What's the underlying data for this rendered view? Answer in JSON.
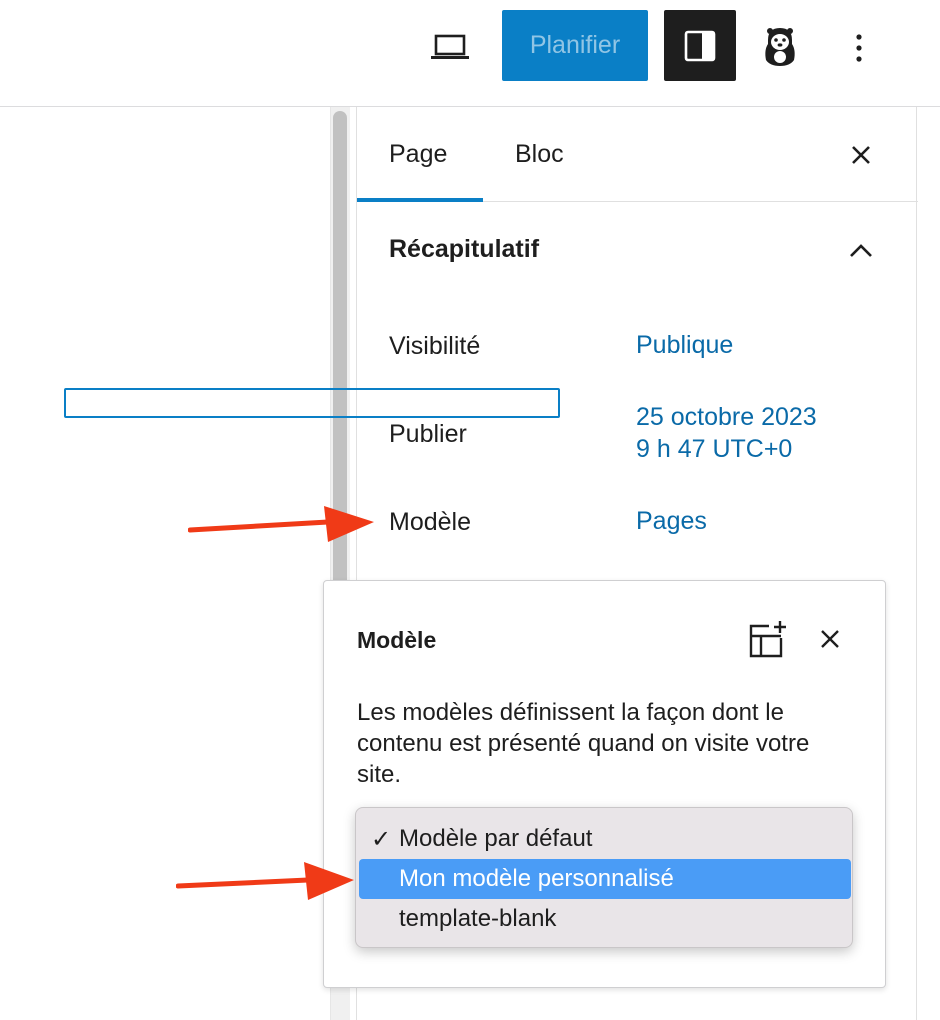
{
  "toolbar": {
    "preview_icon": "laptop-icon",
    "schedule_label": "Planifier",
    "settings_icon": "sidebar-panel-icon",
    "plugin_icon": "animal-mascot-icon",
    "options_icon": "vertical-ellipsis-icon"
  },
  "sidebar": {
    "tabs": [
      {
        "label": "Page",
        "active": true
      },
      {
        "label": "Bloc",
        "active": false
      }
    ],
    "close_icon": "close-icon",
    "panel": {
      "title": "Récapitulatif",
      "toggle_icon": "chevron-up-icon",
      "rows": [
        {
          "label": "Visibilité",
          "value": "Publique"
        },
        {
          "label": "Publier",
          "value_line1": "25 octobre 2023",
          "value_line2": "9 h 47 UTC+0"
        },
        {
          "label": "Modèle",
          "value": "Pages"
        }
      ]
    }
  },
  "popover": {
    "title": "Modèle",
    "add_icon": "add-template-icon",
    "close_icon": "close-icon",
    "description": "Les modèles définissent la façon dont le contenu est présenté quand on visite votre site."
  },
  "dropdown": {
    "options": [
      {
        "label": "Modèle par défaut",
        "checked": true,
        "highlighted": false
      },
      {
        "label": "Mon modèle personnalisé",
        "checked": false,
        "highlighted": true
      },
      {
        "label": "template-blank",
        "checked": false,
        "highlighted": false
      }
    ],
    "check_glyph": "✓"
  },
  "colors": {
    "accent": "#0a7fc6",
    "link": "#0a6aa8",
    "highlight": "#4a9cf6",
    "annotation_arrow": "#f03a17"
  }
}
